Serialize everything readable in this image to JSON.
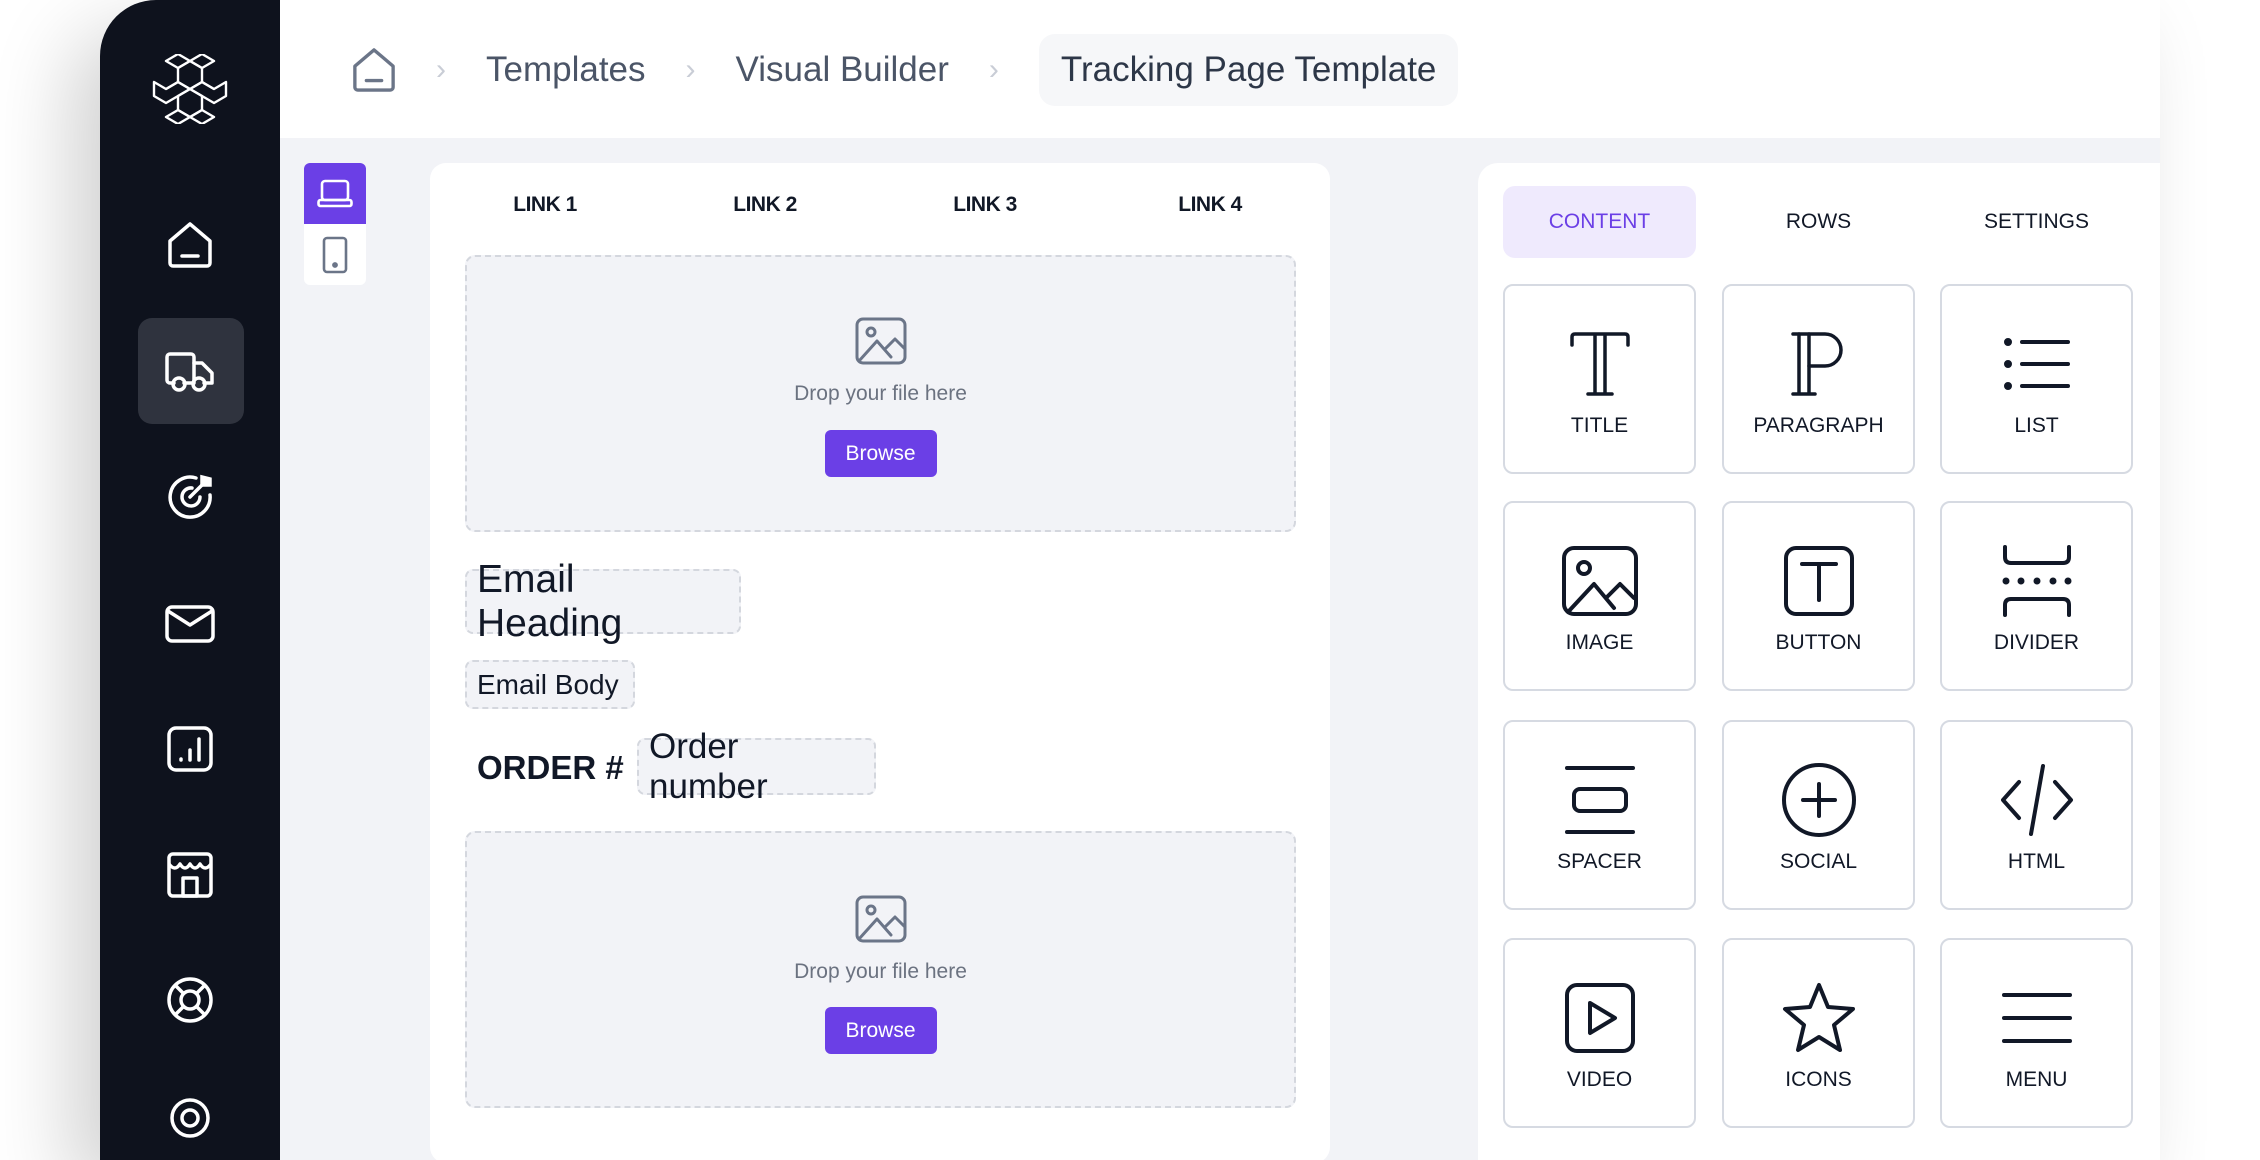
{
  "breadcrumb": {
    "home_icon": "home-icon",
    "items": [
      "Templates",
      "Visual Builder"
    ],
    "current": "Tracking Page Template",
    "separator": "›"
  },
  "sidebar": {
    "logo_icon": "snowflake-cubes-logo",
    "items": [
      {
        "icon": "home-icon",
        "active": false
      },
      {
        "icon": "truck-icon",
        "active": true
      },
      {
        "icon": "target-icon",
        "active": false
      },
      {
        "icon": "mail-icon",
        "active": false
      },
      {
        "icon": "chart-icon",
        "active": false
      },
      {
        "icon": "store-icon",
        "active": false
      },
      {
        "icon": "lifebuoy-icon",
        "active": false
      }
    ]
  },
  "device_toggle": {
    "options": [
      "desktop",
      "mobile"
    ],
    "selected": "desktop"
  },
  "canvas": {
    "links": [
      "LINK 1",
      "LINK 2",
      "LINK 3",
      "LINK 4"
    ],
    "dropzone_text": "Drop your file here",
    "browse_label": "Browse",
    "email_heading": "Email Heading",
    "email_body": "Email Body",
    "order_label": "ORDER #",
    "order_number_placeholder": "Order number"
  },
  "panel": {
    "tabs": [
      {
        "label": "CONTENT",
        "active": true
      },
      {
        "label": "ROWS",
        "active": false
      },
      {
        "label": "SETTINGS",
        "active": false
      }
    ],
    "blocks": [
      {
        "label": "TITLE",
        "icon": "title-icon"
      },
      {
        "label": "PARAGRAPH",
        "icon": "paragraph-icon"
      },
      {
        "label": "LIST",
        "icon": "list-icon"
      },
      {
        "label": "IMAGE",
        "icon": "image-icon"
      },
      {
        "label": "BUTTON",
        "icon": "button-icon"
      },
      {
        "label": "DIVIDER",
        "icon": "divider-icon"
      },
      {
        "label": "SPACER",
        "icon": "spacer-icon"
      },
      {
        "label": "SOCIAL",
        "icon": "social-icon"
      },
      {
        "label": "HTML",
        "icon": "code-icon"
      },
      {
        "label": "VIDEO",
        "icon": "video-icon"
      },
      {
        "label": "ICONS",
        "icon": "star-icon"
      },
      {
        "label": "MENU",
        "icon": "menu-icon"
      }
    ]
  },
  "colors": {
    "accent": "#6b3fe6",
    "sidebar_bg": "#0e121d",
    "sidebar_active": "#2f333e",
    "app_bg": "#f2f3f7",
    "tab_active_bg": "#efeafd"
  }
}
